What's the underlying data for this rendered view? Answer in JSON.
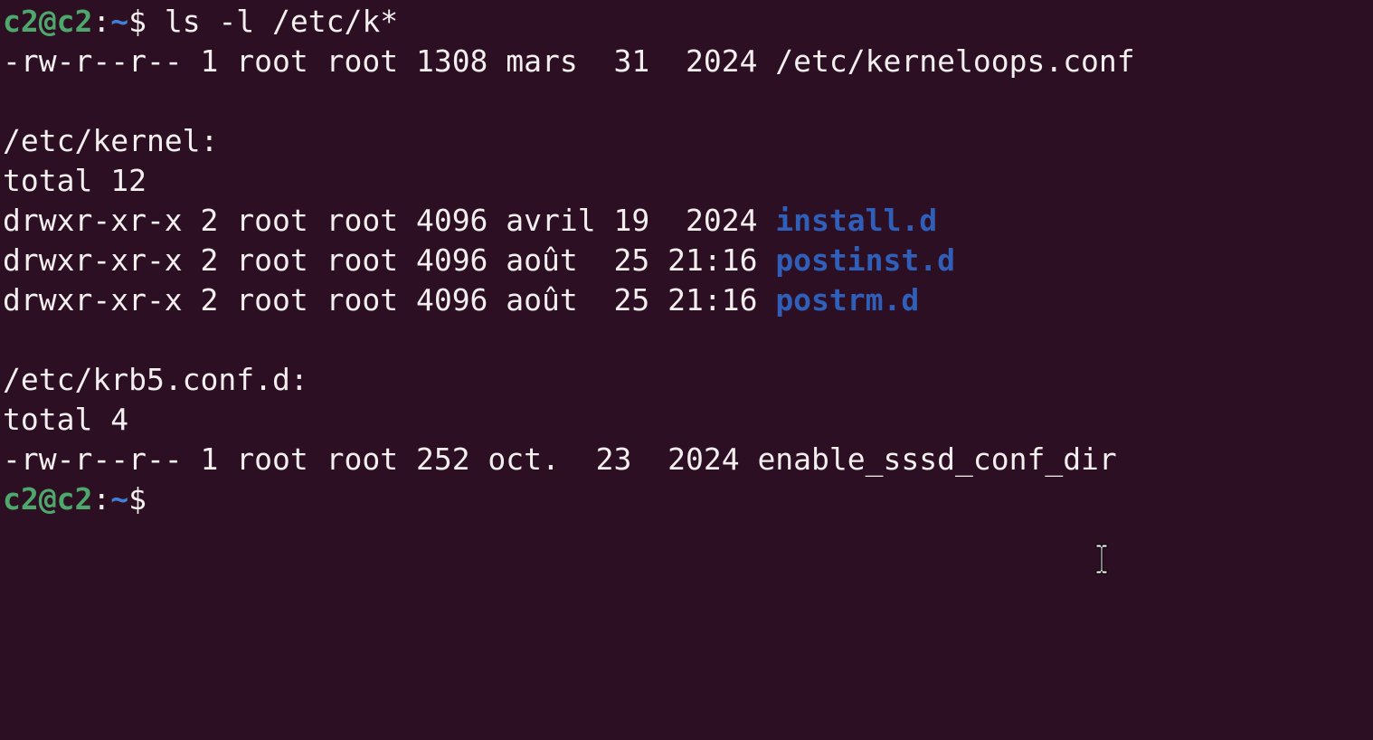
{
  "prompt": {
    "user_host": "c2@c2",
    "separator": ":",
    "path": "~",
    "symbol": "$"
  },
  "command": " ls -l /etc/k*",
  "output": {
    "file_line": "-rw-r--r-- 1 root root 1308 mars  31  2024 /etc/kerneloops.conf",
    "kernel_header": "/etc/kernel:",
    "kernel_total": "total 12",
    "kernel_entries": [
      {
        "meta": "drwxr-xr-x 2 root root 4096 avril 19  2024 ",
        "name": "install.d"
      },
      {
        "meta": "drwxr-xr-x 2 root root 4096 août  25 21:16 ",
        "name": "postinst.d"
      },
      {
        "meta": "drwxr-xr-x 2 root root 4096 août  25 21:16 ",
        "name": "postrm.d"
      }
    ],
    "krb5_header": "/etc/krb5.conf.d:",
    "krb5_total": "total 4",
    "krb5_entry": "-rw-r--r-- 1 root root 252 oct.  23  2024 enable_sssd_conf_dir"
  },
  "colors": {
    "background": "#2d0f24",
    "foreground": "#f2efee",
    "prompt_user": "#4fa86b",
    "prompt_path": "#3f7fd6",
    "directory": "#2f5fb8"
  },
  "cursor_icon": "text-cursor-ibeam-icon"
}
